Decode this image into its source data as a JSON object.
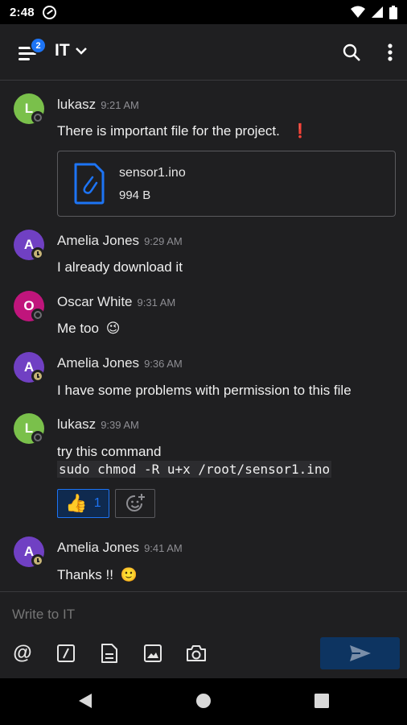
{
  "status_bar": {
    "time": "2:48"
  },
  "header": {
    "room_name": "IT",
    "unread_badge": "2"
  },
  "messages": [
    {
      "initial": "L",
      "avatar_color": "#7ac04b",
      "user": "lukasz",
      "time": "9:21 AM",
      "text": "There is important file for the project.",
      "emoji": "❗",
      "status": "offline",
      "file": {
        "name": "sensor1.ino",
        "size": "994 B"
      }
    },
    {
      "initial": "A",
      "avatar_color": "#7040c3",
      "user": "Amelia Jones",
      "time": "9:29 AM",
      "text": "I already download it",
      "status": "away"
    },
    {
      "initial": "O",
      "avatar_color": "#c0157c",
      "user": "Oscar White",
      "time": "9:31 AM",
      "text": "Me too",
      "emoji": "😉",
      "status": "offline"
    },
    {
      "initial": "A",
      "avatar_color": "#7040c3",
      "user": "Amelia Jones",
      "time": "9:36 AM",
      "text": "I have some problems with permission to this file",
      "status": "away"
    },
    {
      "initial": "L",
      "avatar_color": "#7ac04b",
      "user": "lukasz",
      "time": "9:39 AM",
      "text": "try this command",
      "code": "sudo chmod -R u+x /root/sensor1.ino",
      "status": "offline",
      "reaction": {
        "emoji": "👍",
        "count": "1"
      }
    },
    {
      "initial": "A",
      "avatar_color": "#7040c3",
      "user": "Amelia Jones",
      "time": "9:41 AM",
      "text": "Thanks !!",
      "emoji": "🙂",
      "status": "away"
    }
  ],
  "composer": {
    "placeholder": "Write to IT"
  },
  "colors": {
    "accent": "#1d74f5",
    "background": "#1f1f21",
    "away": "#c6b477"
  }
}
